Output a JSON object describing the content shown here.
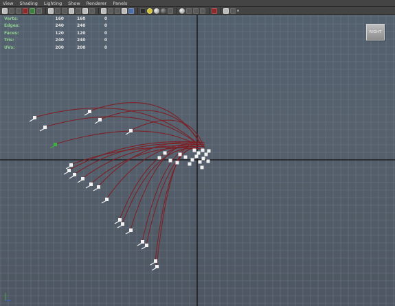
{
  "menubar": {
    "items": [
      "View",
      "Shading",
      "Lighting",
      "Show",
      "Renderer",
      "Panels"
    ]
  },
  "toolbar": {
    "icons": [
      "camera-icon",
      "camera-attributes-icon",
      "bookmark-icon",
      "image-plane-icon",
      "two-d-pan-zoom-icon",
      "grease-pencil-icon",
      "grid-icon",
      "film-gate-icon",
      "resolution-gate-icon",
      "gate-mask-icon",
      "field-chart-icon",
      "safe-action-icon",
      "safe-title-icon",
      "wireframe-icon",
      "smooth-shade-icon",
      "use-default-material-icon",
      "wireframe-on-shaded-icon",
      "x-ray-icon",
      "textured-icon",
      "use-all-lights-icon",
      "shadows-icon",
      "ambient-occlusion-icon",
      "motion-blur-icon",
      "isolate-select-icon",
      "x-ray-joints-icon",
      "x-ray-active-icon",
      "resolution-icon",
      "hud-icon",
      "camera-manipulator-icon",
      "viewport-renderer-icon"
    ]
  },
  "hud": {
    "rows": [
      {
        "label": "Verts:",
        "values": [
          "160",
          "160",
          "0"
        ]
      },
      {
        "label": "Edges:",
        "values": [
          "240",
          "240",
          "0"
        ]
      },
      {
        "label": "Faces:",
        "values": [
          "120",
          "120",
          "0"
        ]
      },
      {
        "label": "Tris:",
        "values": [
          "240",
          "240",
          "0"
        ]
      },
      {
        "label": "UVs:",
        "values": [
          "200",
          "200",
          "0"
        ]
      }
    ]
  },
  "view_cube": {
    "label": "RIGHT"
  },
  "axis_gizmo": {
    "colors": {
      "y": "#4d9c4d",
      "z": "#3a5fc4"
    }
  },
  "colors": {
    "curves": "#7d1f24",
    "grid_major": "#121212",
    "grid_minor": "#6c7784",
    "locators": "#f2f2f2",
    "selected_controller": "#3fb03f"
  }
}
